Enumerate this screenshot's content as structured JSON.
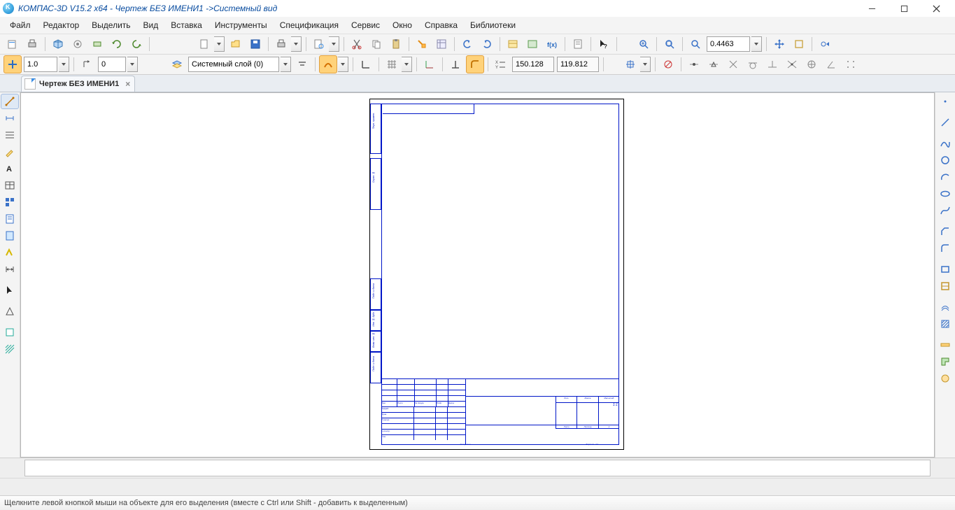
{
  "title": "КОМПАС-3D V15.2  x64 - Чертеж БЕЗ ИМЕНИ1 ->Системный вид",
  "menu": {
    "file": "Файл",
    "editor": "Редактор",
    "select": "Выделить",
    "view": "Вид",
    "insert": "Вставка",
    "tools": "Инструменты",
    "spec": "Спецификация",
    "service": "Сервис",
    "window": "Окно",
    "help": "Справка",
    "libraries": "Библиотеки"
  },
  "toolbar1": {
    "zoom_value": "0.4463"
  },
  "toolbar2": {
    "scale": "1.0",
    "step_value": "0",
    "layer_name": "Системный слой (0)",
    "coord_x": "150.128",
    "coord_y": "119.812"
  },
  "tab": {
    "label": "Чертеж БЕЗ ИМЕНИ1"
  },
  "stamp": {
    "lbl_izm": "Изм.",
    "lbl_list": "Лист",
    "lbl_ndokum": "№ докум.",
    "lbl_podp": "Подп.",
    "lbl_data": "Дата",
    "lbl_razrab": "Разраб.",
    "lbl_prov": "Пров.",
    "lbl_tkontr": "Т.контр.",
    "lbl_nkontr": "Н.контр.",
    "lbl_utv": "Утв.",
    "lbl_lit": "Лит.",
    "lbl_massa": "Масса",
    "lbl_masshtab": "Масштаб",
    "val_masshtab": "1:1",
    "lbl_list2": "Лист",
    "lbl_listov": "Листов",
    "val_listov": "1",
    "lbl_kopiroval": "Копировал",
    "lbl_format": "Формат",
    "val_format": "A4",
    "side_perv": "Перв. примен.",
    "side_sprav": "Справ. №",
    "side_podp_data": "Подп. и дата",
    "side_inv_dubl": "Инв. № дубл.",
    "side_vzam": "Взам. инв. №",
    "side_podp_data2": "Подп. и дата",
    "side_inv_podl": "Инв. № подл."
  },
  "status": "Щелкните левой кнопкой мыши на объекте для его выделения (вместе с Ctrl или Shift - добавить к выделенным)"
}
